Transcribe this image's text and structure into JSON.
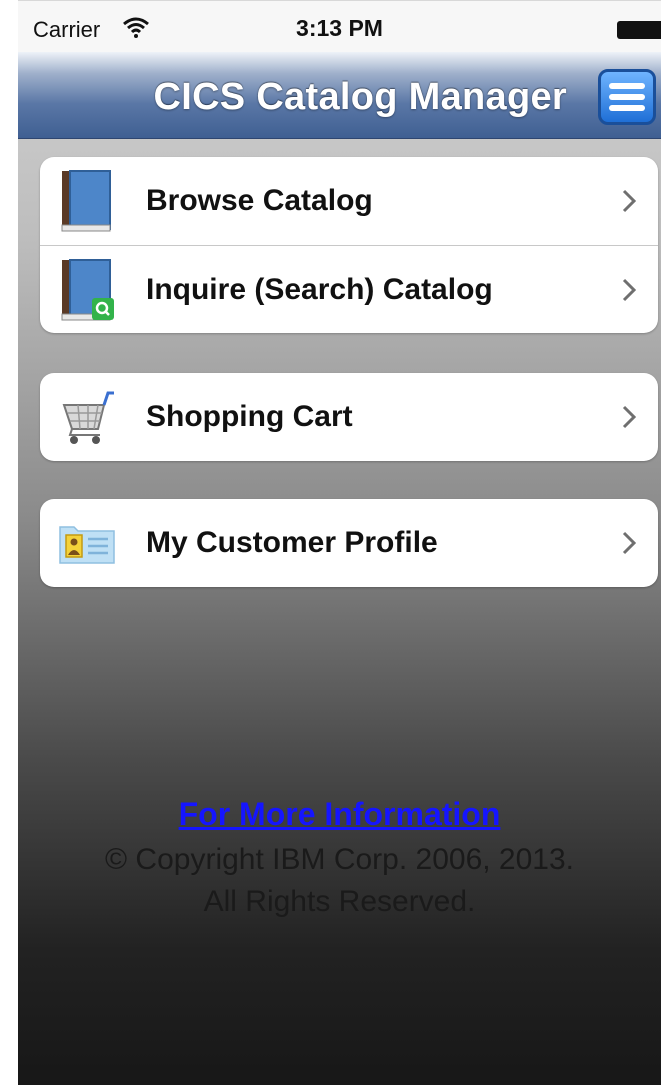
{
  "status_bar": {
    "carrier": "Carrier",
    "time": "3:13 PM"
  },
  "nav": {
    "title": "CICS Catalog Manager",
    "menu_icon": "hamburger-menu-icon"
  },
  "menu_groups": [
    [
      {
        "label": "Browse Catalog",
        "icon": "book-icon"
      },
      {
        "label": "Inquire (Search) Catalog",
        "icon": "book-search-icon"
      }
    ],
    [
      {
        "label": "Shopping Cart",
        "icon": "shopping-cart-icon"
      }
    ],
    [
      {
        "label": "My Customer Profile",
        "icon": "id-card-icon"
      }
    ]
  ],
  "footer": {
    "link_text": "For More Information",
    "copyright_line1": "© Copyright IBM Corp. 2006, 2013.",
    "copyright_line2": "All Rights Reserved."
  },
  "colors": {
    "nav_blue": "#3f5f92",
    "link_blue": "#1515ff",
    "menu_button_blue": "#1f6fd6"
  }
}
